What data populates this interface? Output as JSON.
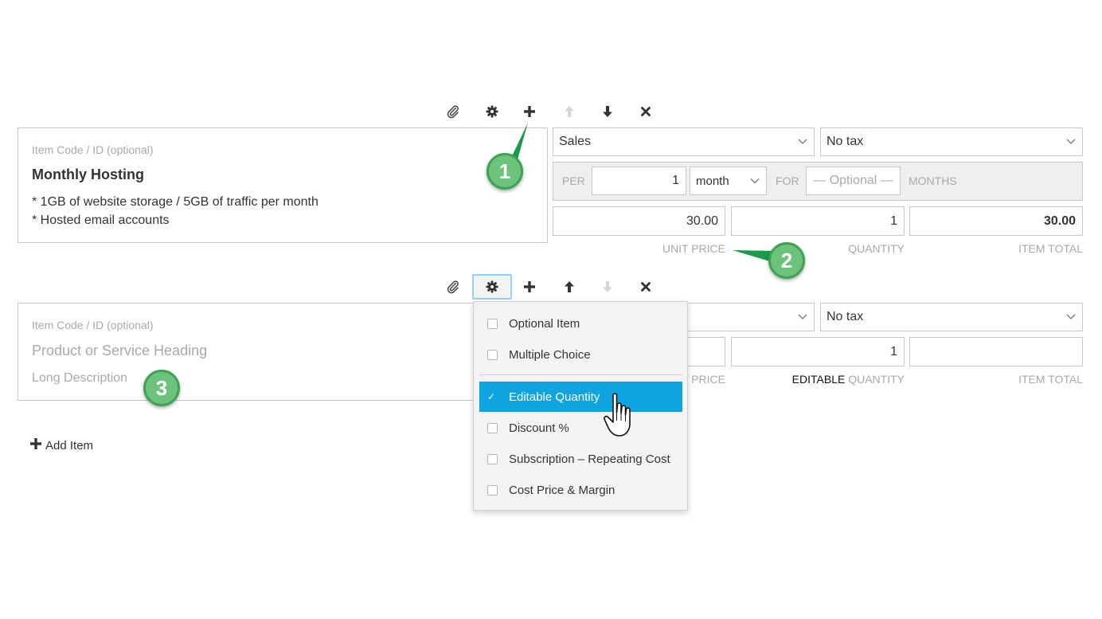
{
  "toolbar_icons": [
    "paperclip-icon",
    "gear-icon",
    "plus-icon",
    "arrow-up-icon",
    "arrow-down-icon",
    "close-icon"
  ],
  "item1": {
    "code_placeholder": "Item Code / ID (optional)",
    "heading": "Monthly Hosting",
    "description": "* 1GB of website storage / 5GB of traffic per month\n* Hosted email accounts",
    "account": "Sales",
    "tax": "No tax",
    "recurring": {
      "per_label": "PER",
      "interval_count": "1",
      "interval_unit": "month",
      "for_label": "FOR",
      "duration_placeholder": "— Optional —",
      "months_label": "MONTHS"
    },
    "unit_price": "30.00",
    "quantity": "1",
    "item_total": "30.00",
    "labels": {
      "unit_price": "UNIT PRICE",
      "quantity": "QUANTITY",
      "item_total": "ITEM TOTAL"
    }
  },
  "item2": {
    "code_placeholder": "Item Code / ID (optional)",
    "heading_placeholder": "Product or Service Heading",
    "description_placeholder": "Long Description",
    "tax": "No tax",
    "quantity": "1",
    "labels": {
      "unit_price_partial": "T PRICE",
      "editable": "EDITABLE",
      "quantity": "QUANTITY",
      "item_total": "ITEM TOTAL"
    }
  },
  "options_menu": {
    "items": [
      {
        "label": "Optional Item",
        "checked": false
      },
      {
        "label": "Multiple Choice",
        "checked": false
      },
      {
        "label": "Editable Quantity",
        "checked": true
      },
      {
        "label": "Discount %",
        "checked": false
      },
      {
        "label": "Subscription – Repeating Cost",
        "checked": false
      },
      {
        "label": "Cost Price & Margin",
        "checked": false
      }
    ],
    "check_glyph": "✓"
  },
  "add_item_label": "Add Item",
  "badges": [
    "1",
    "2",
    "3"
  ],
  "colors": {
    "accent": "#0fa3e0",
    "badge_fill": "#6dc27c",
    "badge_border": "#3ea353",
    "callout_line": "#1a9c4a"
  }
}
